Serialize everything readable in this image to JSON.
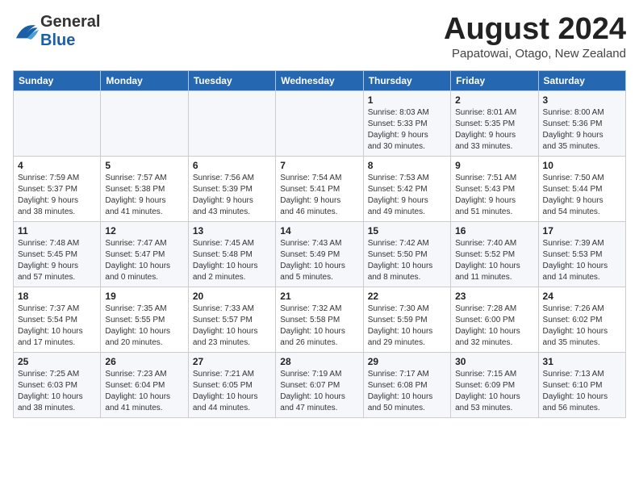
{
  "header": {
    "logo_general": "General",
    "logo_blue": "Blue",
    "month_title": "August 2024",
    "subtitle": "Papatowai, Otago, New Zealand"
  },
  "days_of_week": [
    "Sunday",
    "Monday",
    "Tuesday",
    "Wednesday",
    "Thursday",
    "Friday",
    "Saturday"
  ],
  "weeks": [
    [
      {
        "day": "",
        "info": ""
      },
      {
        "day": "",
        "info": ""
      },
      {
        "day": "",
        "info": ""
      },
      {
        "day": "",
        "info": ""
      },
      {
        "day": "1",
        "info": "Sunrise: 8:03 AM\nSunset: 5:33 PM\nDaylight: 9 hours\nand 30 minutes."
      },
      {
        "day": "2",
        "info": "Sunrise: 8:01 AM\nSunset: 5:35 PM\nDaylight: 9 hours\nand 33 minutes."
      },
      {
        "day": "3",
        "info": "Sunrise: 8:00 AM\nSunset: 5:36 PM\nDaylight: 9 hours\nand 35 minutes."
      }
    ],
    [
      {
        "day": "4",
        "info": "Sunrise: 7:59 AM\nSunset: 5:37 PM\nDaylight: 9 hours\nand 38 minutes."
      },
      {
        "day": "5",
        "info": "Sunrise: 7:57 AM\nSunset: 5:38 PM\nDaylight: 9 hours\nand 41 minutes."
      },
      {
        "day": "6",
        "info": "Sunrise: 7:56 AM\nSunset: 5:39 PM\nDaylight: 9 hours\nand 43 minutes."
      },
      {
        "day": "7",
        "info": "Sunrise: 7:54 AM\nSunset: 5:41 PM\nDaylight: 9 hours\nand 46 minutes."
      },
      {
        "day": "8",
        "info": "Sunrise: 7:53 AM\nSunset: 5:42 PM\nDaylight: 9 hours\nand 49 minutes."
      },
      {
        "day": "9",
        "info": "Sunrise: 7:51 AM\nSunset: 5:43 PM\nDaylight: 9 hours\nand 51 minutes."
      },
      {
        "day": "10",
        "info": "Sunrise: 7:50 AM\nSunset: 5:44 PM\nDaylight: 9 hours\nand 54 minutes."
      }
    ],
    [
      {
        "day": "11",
        "info": "Sunrise: 7:48 AM\nSunset: 5:45 PM\nDaylight: 9 hours\nand 57 minutes."
      },
      {
        "day": "12",
        "info": "Sunrise: 7:47 AM\nSunset: 5:47 PM\nDaylight: 10 hours\nand 0 minutes."
      },
      {
        "day": "13",
        "info": "Sunrise: 7:45 AM\nSunset: 5:48 PM\nDaylight: 10 hours\nand 2 minutes."
      },
      {
        "day": "14",
        "info": "Sunrise: 7:43 AM\nSunset: 5:49 PM\nDaylight: 10 hours\nand 5 minutes."
      },
      {
        "day": "15",
        "info": "Sunrise: 7:42 AM\nSunset: 5:50 PM\nDaylight: 10 hours\nand 8 minutes."
      },
      {
        "day": "16",
        "info": "Sunrise: 7:40 AM\nSunset: 5:52 PM\nDaylight: 10 hours\nand 11 minutes."
      },
      {
        "day": "17",
        "info": "Sunrise: 7:39 AM\nSunset: 5:53 PM\nDaylight: 10 hours\nand 14 minutes."
      }
    ],
    [
      {
        "day": "18",
        "info": "Sunrise: 7:37 AM\nSunset: 5:54 PM\nDaylight: 10 hours\nand 17 minutes."
      },
      {
        "day": "19",
        "info": "Sunrise: 7:35 AM\nSunset: 5:55 PM\nDaylight: 10 hours\nand 20 minutes."
      },
      {
        "day": "20",
        "info": "Sunrise: 7:33 AM\nSunset: 5:57 PM\nDaylight: 10 hours\nand 23 minutes."
      },
      {
        "day": "21",
        "info": "Sunrise: 7:32 AM\nSunset: 5:58 PM\nDaylight: 10 hours\nand 26 minutes."
      },
      {
        "day": "22",
        "info": "Sunrise: 7:30 AM\nSunset: 5:59 PM\nDaylight: 10 hours\nand 29 minutes."
      },
      {
        "day": "23",
        "info": "Sunrise: 7:28 AM\nSunset: 6:00 PM\nDaylight: 10 hours\nand 32 minutes."
      },
      {
        "day": "24",
        "info": "Sunrise: 7:26 AM\nSunset: 6:02 PM\nDaylight: 10 hours\nand 35 minutes."
      }
    ],
    [
      {
        "day": "25",
        "info": "Sunrise: 7:25 AM\nSunset: 6:03 PM\nDaylight: 10 hours\nand 38 minutes."
      },
      {
        "day": "26",
        "info": "Sunrise: 7:23 AM\nSunset: 6:04 PM\nDaylight: 10 hours\nand 41 minutes."
      },
      {
        "day": "27",
        "info": "Sunrise: 7:21 AM\nSunset: 6:05 PM\nDaylight: 10 hours\nand 44 minutes."
      },
      {
        "day": "28",
        "info": "Sunrise: 7:19 AM\nSunset: 6:07 PM\nDaylight: 10 hours\nand 47 minutes."
      },
      {
        "day": "29",
        "info": "Sunrise: 7:17 AM\nSunset: 6:08 PM\nDaylight: 10 hours\nand 50 minutes."
      },
      {
        "day": "30",
        "info": "Sunrise: 7:15 AM\nSunset: 6:09 PM\nDaylight: 10 hours\nand 53 minutes."
      },
      {
        "day": "31",
        "info": "Sunrise: 7:13 AM\nSunset: 6:10 PM\nDaylight: 10 hours\nand 56 minutes."
      }
    ]
  ]
}
